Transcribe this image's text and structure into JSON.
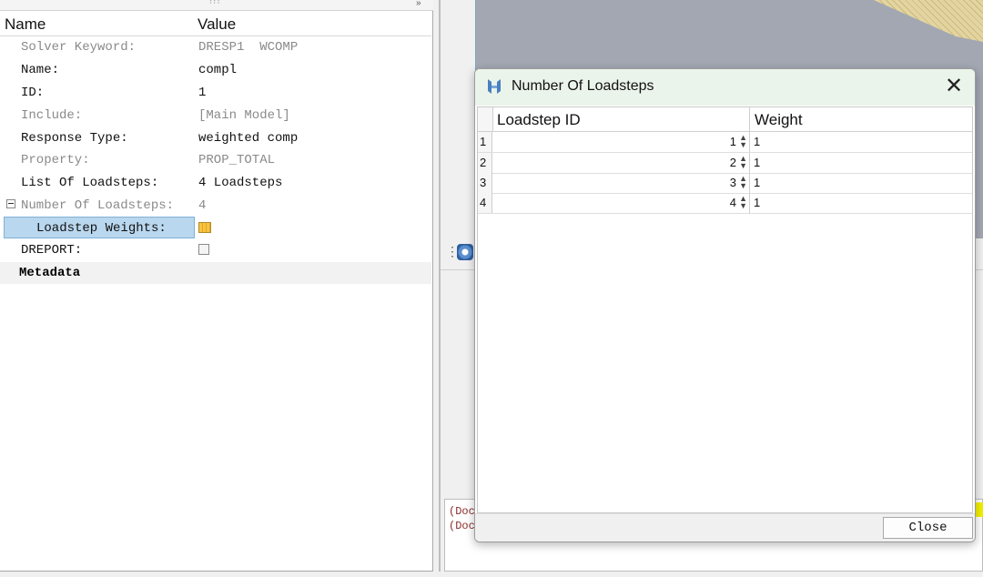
{
  "properties_panel": {
    "header": {
      "name_col": "Name",
      "value_col": "Value"
    },
    "rows": [
      {
        "label": "Solver Keyword:",
        "value": "DRESP1  WCOMP"
      },
      {
        "label": "Name:",
        "value": "compl"
      },
      {
        "label": "ID:",
        "value": "1"
      },
      {
        "label": "Include:",
        "value": "[Main Model]"
      },
      {
        "label": "Response Type:",
        "value": "weighted comp"
      },
      {
        "label": "Property:",
        "value": "PROP_TOTAL"
      },
      {
        "label": "List Of Loadsteps:",
        "value": "4 Loadsteps"
      },
      {
        "label": "Number Of Loadsteps:",
        "value": "4"
      },
      {
        "label": "Loadstep Weights:",
        "icon": "table-edit-icon"
      },
      {
        "label": "DREPORT:",
        "checked": false
      }
    ],
    "metadata_label": "Metadata"
  },
  "console": {
    "lines": [
      "(Doc",
      "(Doc"
    ]
  },
  "dialog": {
    "title": "Number Of Loadsteps",
    "columns": {
      "row_header": "",
      "loadstep_id": "Loadstep ID",
      "weight": "Weight"
    },
    "rows": [
      {
        "row": "1",
        "loadstep_id": "1",
        "weight": "1"
      },
      {
        "row": "2",
        "loadstep_id": "2",
        "weight": "1"
      },
      {
        "row": "3",
        "loadstep_id": "3",
        "weight": "1"
      },
      {
        "row": "4",
        "loadstep_id": "4",
        "weight": "1"
      }
    ],
    "close_label": "Close",
    "close_glyph": "✕"
  },
  "colors": {
    "selection": "#b9d7ee",
    "dialog_titlebar": "#ebf4ea",
    "viewport": "#a3a7b2",
    "logo_blue": "#4a7fc0"
  }
}
